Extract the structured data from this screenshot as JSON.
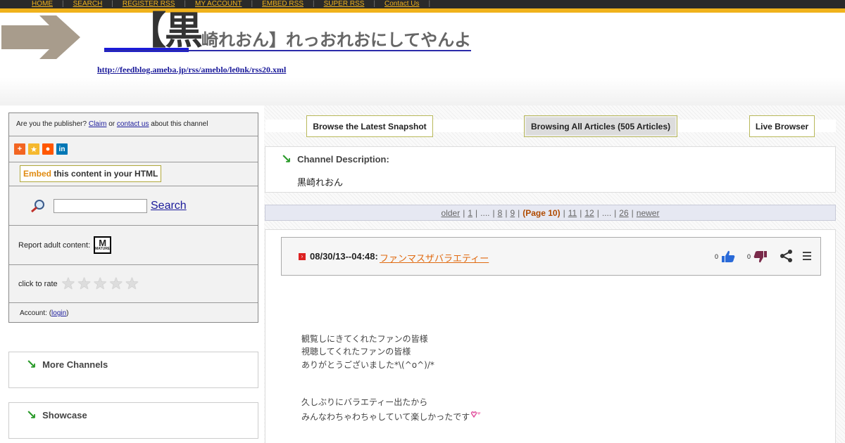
{
  "topnav": {
    "items": [
      "HOME",
      "SEARCH",
      "REGISTER RSS",
      "MY ACCOUNT",
      "EMBED RSS",
      "SUPER RSS",
      "Contact Us"
    ]
  },
  "header": {
    "title_big": "【黒",
    "title_rest": "崎れおん】れっおれおにしてやんよ",
    "feed_url": "http://feedblog.ameba.jp/rss/ameblo/le0nk/rss20.xml"
  },
  "sidebar": {
    "publisher_prefix": "Are you the publisher?",
    "claim": "Claim",
    "or": "or",
    "contact": "contact us",
    "publisher_suffix": "about this channel",
    "embed_word": "Embed",
    "embed_rest": "this content in your HTML",
    "search_button": "Search",
    "search_value": "",
    "adult_label": "Report adult content:",
    "adult_badge": "M",
    "adult_badge_small": "MATURE",
    "rate_label": "click to rate",
    "rating": 0,
    "account_prefix": "Account: (",
    "login": "login",
    "account_suffix": ")",
    "more_channels": "More Channels",
    "showcase": "Showcase"
  },
  "tabs": {
    "latest": "Browse the Latest Snapshot",
    "all": "Browsing All Articles (505 Articles)",
    "live": "Live Browser"
  },
  "description": {
    "header": "Channel Description:",
    "text": "黒崎れおん"
  },
  "pager": {
    "older": "older",
    "p1": "1",
    "dots": "....",
    "p8": "8",
    "p9": "9",
    "current": "(Page 10)",
    "p11": "11",
    "p12": "12",
    "p26": "26",
    "newer": "newer",
    "sep": "|"
  },
  "article": {
    "date": "08/30/13--04:48:",
    "title": "ファンマスザバラエティー",
    "likes": "0",
    "dislikes": "0",
    "lines": [
      "観覧しにきてくれたファンの皆様",
      "視聴してくれたファンの皆様",
      "ありがとうございました*\\(^o^)/*",
      "久しぶりにバラエティー出たから",
      "みんなわちゃわちゃしていて楽しかったです"
    ]
  },
  "colors": {
    "nav_bg": "#2a2a2a",
    "accent_yellow": "#f0b21c",
    "link_blue": "#1a1a9a",
    "orange_link": "#e06a10",
    "like_blue": "#2a6ad8",
    "dislike_purple": "#7a2a4a"
  }
}
